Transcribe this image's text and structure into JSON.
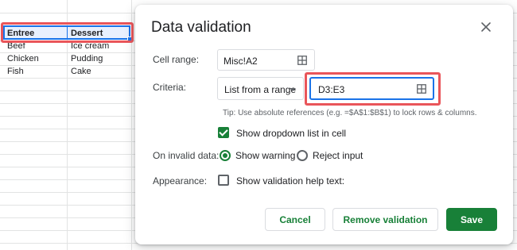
{
  "sheet": {
    "headers": [
      "Entree",
      "Dessert"
    ],
    "rows": [
      [
        "Beef",
        "Ice cream"
      ],
      [
        "Chicken",
        "Pudding"
      ],
      [
        "Fish",
        "Cake"
      ]
    ]
  },
  "dialog": {
    "title": "Data validation",
    "cell_range_label": "Cell range:",
    "cell_range_value": "Misc!A2",
    "criteria_label": "Criteria:",
    "criteria_type": "List from a range",
    "criteria_value": "D3:E3",
    "tip": "Tip: Use absolute references (e.g. =$A$1:$B$1) to lock rows & columns.",
    "show_dropdown_label": "Show dropdown list in cell",
    "show_dropdown_checked": true,
    "invalid_label": "On invalid data:",
    "show_warning_label": "Show warning",
    "reject_input_label": "Reject input",
    "selected_invalid_option": "Show warning",
    "appearance_label": "Appearance:",
    "help_text_label": "Show validation help text:",
    "help_text_checked": false,
    "cancel_label": "Cancel",
    "remove_label": "Remove validation",
    "save_label": "Save"
  },
  "colors": {
    "accent_green": "#188038",
    "selection_blue": "#1a73e8",
    "highlight_red": "#e9555a"
  }
}
